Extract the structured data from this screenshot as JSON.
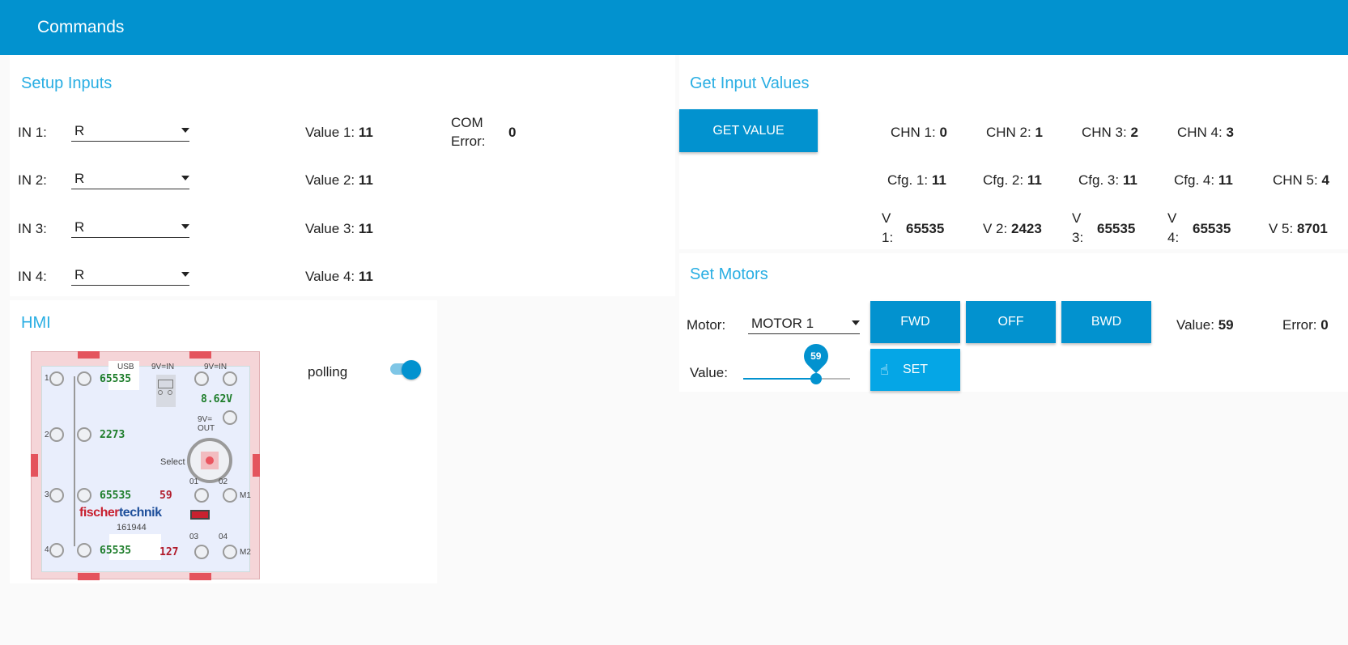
{
  "header": {
    "title": "Commands"
  },
  "setup_inputs": {
    "title": "Setup Inputs",
    "rows": [
      {
        "label": "IN 1:",
        "mode": "R",
        "value_label": "Value 1:",
        "value": "11"
      },
      {
        "label": "IN 2:",
        "mode": "R",
        "value_label": "Value 2:",
        "value": "11"
      },
      {
        "label": "IN 3:",
        "mode": "R",
        "value_label": "Value 3:",
        "value": "11"
      },
      {
        "label": "IN 4:",
        "mode": "R",
        "value_label": "Value 4:",
        "value": "11"
      }
    ],
    "com_error_label_1": "COM",
    "com_error_label_2": "Error:",
    "com_error_value": "0"
  },
  "get_input_values": {
    "title": "Get Input Values",
    "button_label": "GET VALUE",
    "chn": [
      {
        "label": "CHN 1:",
        "value": "0"
      },
      {
        "label": "CHN 2:",
        "value": "1"
      },
      {
        "label": "CHN 3:",
        "value": "2"
      },
      {
        "label": "CHN 4:",
        "value": "3"
      },
      {
        "label": "CHN 5:",
        "value": "4"
      }
    ],
    "cfg": [
      {
        "label": "Cfg. 1:",
        "value": "11"
      },
      {
        "label": "Cfg. 2:",
        "value": "11"
      },
      {
        "label": "Cfg. 3:",
        "value": "11"
      },
      {
        "label": "Cfg. 4:",
        "value": "11"
      }
    ],
    "v": [
      {
        "label_a": "V",
        "label_b": "1:",
        "value": "65535"
      },
      {
        "label": "V 2:",
        "value": "2423"
      },
      {
        "label_a": "V",
        "label_b": "3:",
        "value": "65535"
      },
      {
        "label_a": "V",
        "label_b": "4:",
        "value": "65535"
      },
      {
        "label": "V 5:",
        "value": "8701"
      }
    ]
  },
  "set_motors": {
    "title": "Set Motors",
    "motor_label": "Motor:",
    "motor_selected": "MOTOR 1",
    "fwd_label": "FWD",
    "off_label": "OFF",
    "bwd_label": "BWD",
    "value_label": "Value:",
    "value": "59",
    "error_label": "Error:",
    "error_value": "0",
    "slider_label": "Value:",
    "slider_value": 59,
    "slider_fraction": 0.68,
    "set_label": "SET"
  },
  "hmi": {
    "title": "HMI",
    "polling_label": "polling",
    "polling_on": true,
    "board": {
      "usb": "USB",
      "nine_v_in_1": "9V=IN",
      "nine_v_in_2": "9V=IN",
      "voltage": "8.62V",
      "nine_v_out_a": "9V=",
      "nine_v_out_b": "OUT",
      "select": "Select",
      "in_numbers": [
        "1",
        "2",
        "3",
        "4"
      ],
      "in_values": [
        "65535",
        "2273",
        "65535",
        "65535"
      ],
      "m1_value": "59",
      "m2_value": "127",
      "o1": "01",
      "o2": "02",
      "o3": "03",
      "o4": "04",
      "m1": "M1",
      "m2": "M2",
      "brand_red": "fischer",
      "brand_blue": "technik",
      "model_no": "161944"
    }
  },
  "colors": {
    "accent": "#0292cf",
    "title_blue": "#29aee3",
    "green": "#1d7d2a",
    "red": "#b11a2a"
  }
}
